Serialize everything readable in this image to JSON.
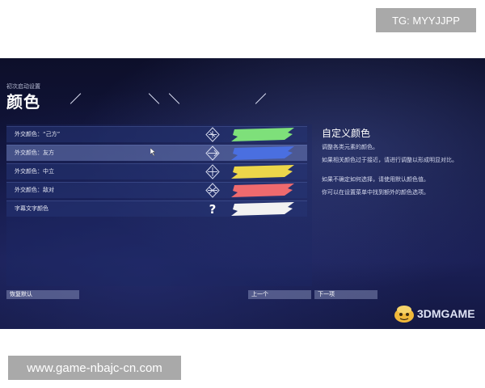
{
  "watermarks": {
    "top": "TG: MYYJJPP",
    "bottom": "www.game-nbajc-cn.com"
  },
  "header": {
    "breadcrumb": "初次启动设置",
    "title": "颜色",
    "subtitle_small": "",
    "has_slashes": true
  },
  "rows": [
    {
      "label": "外交颜色：“己方”",
      "color": "#7ee07a",
      "icon": "diplomacy-self-icon",
      "selected": false
    },
    {
      "label": "外交颜色：友方",
      "color": "#4a6fe0",
      "icon": "diplomacy-ally-icon",
      "selected": true
    },
    {
      "label": "外交颜色：中立",
      "color": "#ecd64a",
      "icon": "diplomacy-neutral-icon",
      "selected": false
    },
    {
      "label": "外交颜色：敌对",
      "color": "#ef6a6e",
      "icon": "diplomacy-enemy-icon",
      "selected": false
    },
    {
      "label": "字幕文字颜色",
      "color": "#f2f2f2",
      "icon": "question-icon",
      "selected": false
    }
  ],
  "right_panel": {
    "title": "自定义颜色",
    "paragraphs": [
      "调整各类元素的颜色。",
      "如果相关颜色过于接近，请进行调整以形成明显对比。",
      "如果不确定如何选择，请使用默认颜色值。",
      "你可以在设置菜单中找到额外的颜色选项。"
    ]
  },
  "buttons": {
    "reset": "恢复默认",
    "prev": "上一个",
    "next": "下一项"
  },
  "logo": {
    "text": "3DMGAME"
  },
  "colors": {
    "background_top": "#0d0f2a",
    "background_bottom": "#1a1f55",
    "watermark_bg": "#a9a9a9"
  }
}
